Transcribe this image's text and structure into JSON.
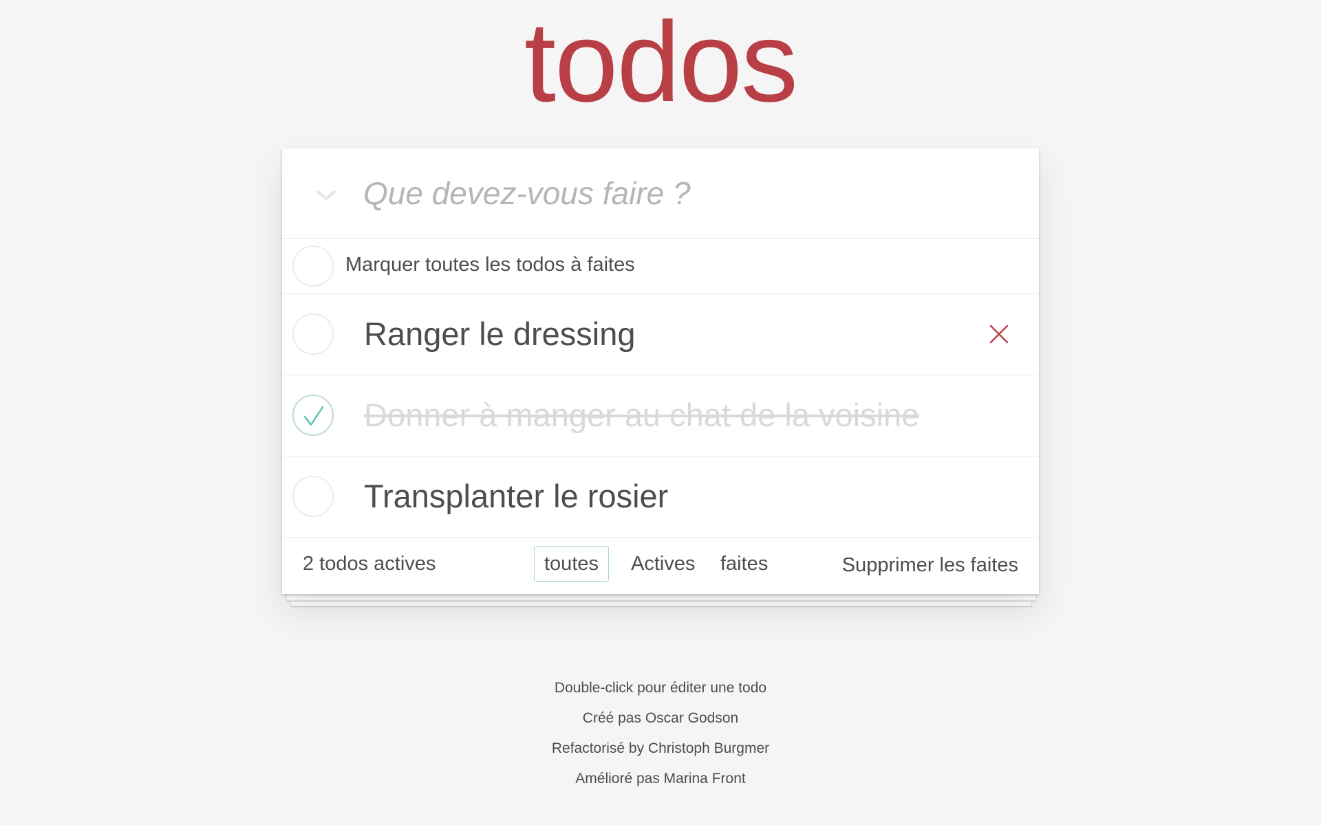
{
  "app": {
    "title": "todos"
  },
  "new_todo": {
    "placeholder": "Que devez-vous faire ?"
  },
  "toggle_all": {
    "label": "Marquer toutes les todos à faites"
  },
  "todos": [
    {
      "label": "Ranger le dressing",
      "completed": false
    },
    {
      "label": "Donner à manger au chat de la voisine",
      "completed": true
    },
    {
      "label": "Transplanter le rosier",
      "completed": false
    }
  ],
  "footer": {
    "count": "2 todos actives",
    "filters": [
      {
        "label": "toutes",
        "selected": true
      },
      {
        "label": "Actives",
        "selected": false
      },
      {
        "label": "faites",
        "selected": false
      }
    ],
    "clear_completed": "Supprimer les faites"
  },
  "info": {
    "lines": [
      "Double-click pour éditer une todo",
      "Créé pas Oscar Godson",
      "Refactorisé by Christoph Burgmer",
      "Amélioré pas Marina Front"
    ]
  },
  "colors": {
    "title": "#b83f45",
    "destroy": "#b83f45",
    "check": "#5dc2af",
    "selected_filter_border": "#a7d6d2",
    "background": "#f5f5f5"
  },
  "icons": {
    "toggle_all": "chevron-down-icon",
    "destroy": "close-icon",
    "completed": "checkmark-icon"
  }
}
